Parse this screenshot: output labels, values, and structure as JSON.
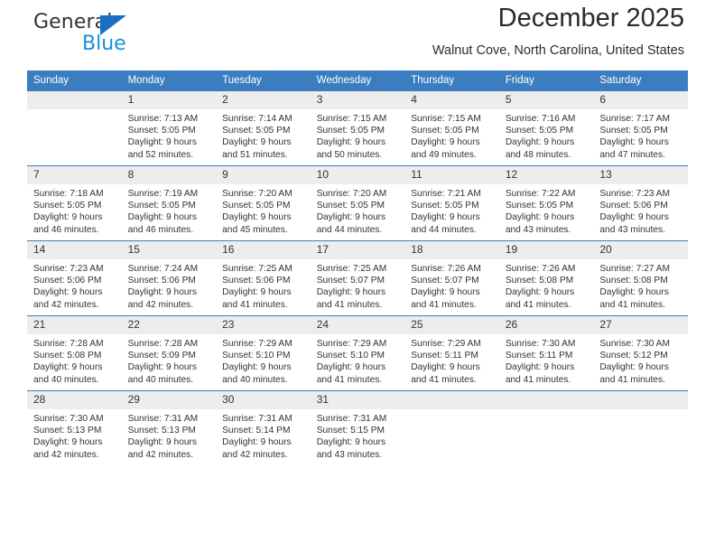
{
  "brand": {
    "name_dark": "General",
    "name_blue": "Blue",
    "triangle_color": "#1a6fc4",
    "blue_color": "#1a8fe0"
  },
  "header": {
    "month_title": "December 2025",
    "location": "Walnut Cove, North Carolina, United States",
    "header_bg": "#3b7dc0",
    "daynum_bg": "#ededed"
  },
  "weekdays": [
    "Sunday",
    "Monday",
    "Tuesday",
    "Wednesday",
    "Thursday",
    "Friday",
    "Saturday"
  ],
  "weeks": [
    [
      {
        "day": "",
        "info": "",
        "empty": true
      },
      {
        "day": "1",
        "info": "Sunrise: 7:13 AM\nSunset: 5:05 PM\nDaylight: 9 hours\nand 52 minutes."
      },
      {
        "day": "2",
        "info": "Sunrise: 7:14 AM\nSunset: 5:05 PM\nDaylight: 9 hours\nand 51 minutes."
      },
      {
        "day": "3",
        "info": "Sunrise: 7:15 AM\nSunset: 5:05 PM\nDaylight: 9 hours\nand 50 minutes."
      },
      {
        "day": "4",
        "info": "Sunrise: 7:15 AM\nSunset: 5:05 PM\nDaylight: 9 hours\nand 49 minutes."
      },
      {
        "day": "5",
        "info": "Sunrise: 7:16 AM\nSunset: 5:05 PM\nDaylight: 9 hours\nand 48 minutes."
      },
      {
        "day": "6",
        "info": "Sunrise: 7:17 AM\nSunset: 5:05 PM\nDaylight: 9 hours\nand 47 minutes."
      }
    ],
    [
      {
        "day": "7",
        "info": "Sunrise: 7:18 AM\nSunset: 5:05 PM\nDaylight: 9 hours\nand 46 minutes."
      },
      {
        "day": "8",
        "info": "Sunrise: 7:19 AM\nSunset: 5:05 PM\nDaylight: 9 hours\nand 46 minutes."
      },
      {
        "day": "9",
        "info": "Sunrise: 7:20 AM\nSunset: 5:05 PM\nDaylight: 9 hours\nand 45 minutes."
      },
      {
        "day": "10",
        "info": "Sunrise: 7:20 AM\nSunset: 5:05 PM\nDaylight: 9 hours\nand 44 minutes."
      },
      {
        "day": "11",
        "info": "Sunrise: 7:21 AM\nSunset: 5:05 PM\nDaylight: 9 hours\nand 44 minutes."
      },
      {
        "day": "12",
        "info": "Sunrise: 7:22 AM\nSunset: 5:05 PM\nDaylight: 9 hours\nand 43 minutes."
      },
      {
        "day": "13",
        "info": "Sunrise: 7:23 AM\nSunset: 5:06 PM\nDaylight: 9 hours\nand 43 minutes."
      }
    ],
    [
      {
        "day": "14",
        "info": "Sunrise: 7:23 AM\nSunset: 5:06 PM\nDaylight: 9 hours\nand 42 minutes."
      },
      {
        "day": "15",
        "info": "Sunrise: 7:24 AM\nSunset: 5:06 PM\nDaylight: 9 hours\nand 42 minutes."
      },
      {
        "day": "16",
        "info": "Sunrise: 7:25 AM\nSunset: 5:06 PM\nDaylight: 9 hours\nand 41 minutes."
      },
      {
        "day": "17",
        "info": "Sunrise: 7:25 AM\nSunset: 5:07 PM\nDaylight: 9 hours\nand 41 minutes."
      },
      {
        "day": "18",
        "info": "Sunrise: 7:26 AM\nSunset: 5:07 PM\nDaylight: 9 hours\nand 41 minutes."
      },
      {
        "day": "19",
        "info": "Sunrise: 7:26 AM\nSunset: 5:08 PM\nDaylight: 9 hours\nand 41 minutes."
      },
      {
        "day": "20",
        "info": "Sunrise: 7:27 AM\nSunset: 5:08 PM\nDaylight: 9 hours\nand 41 minutes."
      }
    ],
    [
      {
        "day": "21",
        "info": "Sunrise: 7:28 AM\nSunset: 5:08 PM\nDaylight: 9 hours\nand 40 minutes."
      },
      {
        "day": "22",
        "info": "Sunrise: 7:28 AM\nSunset: 5:09 PM\nDaylight: 9 hours\nand 40 minutes."
      },
      {
        "day": "23",
        "info": "Sunrise: 7:29 AM\nSunset: 5:10 PM\nDaylight: 9 hours\nand 40 minutes."
      },
      {
        "day": "24",
        "info": "Sunrise: 7:29 AM\nSunset: 5:10 PM\nDaylight: 9 hours\nand 41 minutes."
      },
      {
        "day": "25",
        "info": "Sunrise: 7:29 AM\nSunset: 5:11 PM\nDaylight: 9 hours\nand 41 minutes."
      },
      {
        "day": "26",
        "info": "Sunrise: 7:30 AM\nSunset: 5:11 PM\nDaylight: 9 hours\nand 41 minutes."
      },
      {
        "day": "27",
        "info": "Sunrise: 7:30 AM\nSunset: 5:12 PM\nDaylight: 9 hours\nand 41 minutes."
      }
    ],
    [
      {
        "day": "28",
        "info": "Sunrise: 7:30 AM\nSunset: 5:13 PM\nDaylight: 9 hours\nand 42 minutes."
      },
      {
        "day": "29",
        "info": "Sunrise: 7:31 AM\nSunset: 5:13 PM\nDaylight: 9 hours\nand 42 minutes."
      },
      {
        "day": "30",
        "info": "Sunrise: 7:31 AM\nSunset: 5:14 PM\nDaylight: 9 hours\nand 42 minutes."
      },
      {
        "day": "31",
        "info": "Sunrise: 7:31 AM\nSunset: 5:15 PM\nDaylight: 9 hours\nand 43 minutes."
      },
      {
        "day": "",
        "info": "",
        "empty": true
      },
      {
        "day": "",
        "info": "",
        "empty": true
      },
      {
        "day": "",
        "info": "",
        "empty": true
      }
    ]
  ]
}
